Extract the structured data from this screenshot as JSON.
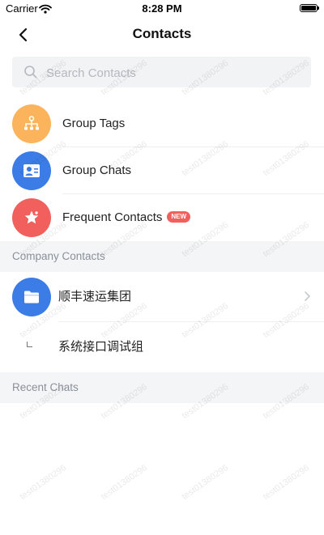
{
  "status_bar": {
    "carrier": "Carrier",
    "time": "8:28 PM"
  },
  "nav": {
    "title": "Contacts"
  },
  "search": {
    "placeholder": "Search Contacts"
  },
  "quick_items": [
    {
      "label": "Group Tags",
      "icon": "group-tags-icon",
      "color": "#fbb45c"
    },
    {
      "label": "Group Chats",
      "icon": "group-chats-icon",
      "color": "#3b7ce6"
    },
    {
      "label": "Frequent Contacts",
      "icon": "star-icon",
      "color": "#f2605e",
      "badge": "NEW"
    }
  ],
  "company_section": {
    "header": "Company Contacts",
    "items": [
      {
        "label": "顺丰速运集团",
        "icon": "folder-icon",
        "color": "#3b7ce6"
      },
      {
        "label": "系统接口调试组"
      }
    ]
  },
  "recent_section": {
    "header": "Recent Chats"
  },
  "watermark": "test01380296"
}
